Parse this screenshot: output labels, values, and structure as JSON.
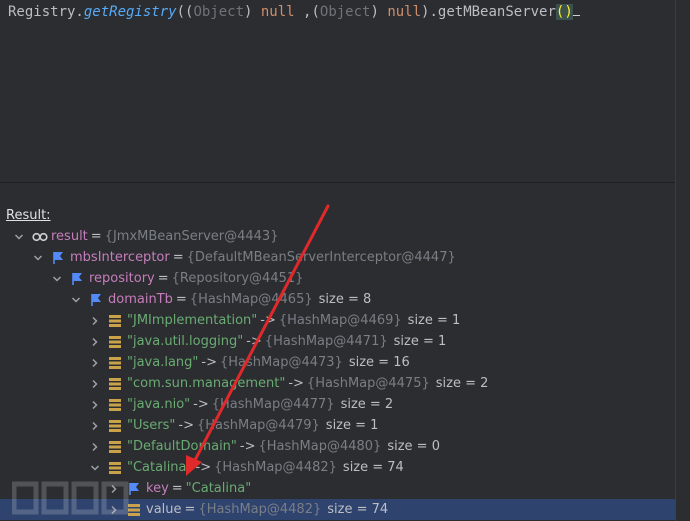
{
  "editor": {
    "tokens": {
      "registry": "Registry.",
      "getRegistry": "getRegistry",
      "open1": "((",
      "object1": "Object",
      "close1": ") ",
      "null1": "null",
      "comma": " ,(",
      "object2": "Object",
      "close2": ") ",
      "null2": "null",
      "tail": ").getMBeanServer",
      "parens": "()"
    }
  },
  "result_label": "Result:",
  "tree": [
    {
      "indent": 0,
      "expand": "down",
      "icon": "watch-icon",
      "name": "result",
      "name_style": "purple",
      "op": "=",
      "value": "{JmxMBeanServer@4443}",
      "size": ""
    },
    {
      "indent": 1,
      "expand": "down",
      "icon": "field-flag-icon",
      "name": "mbsInterceptor",
      "name_style": "purple",
      "op": "=",
      "value": "{DefaultMBeanServerInterceptor@4447}",
      "size": ""
    },
    {
      "indent": 2,
      "expand": "down",
      "icon": "field-flag-icon",
      "name": "repository",
      "name_style": "purple",
      "op": "=",
      "value": "{Repository@4451}",
      "size": ""
    },
    {
      "indent": 3,
      "expand": "down",
      "icon": "field-flag-icon",
      "name": "domainTb",
      "name_style": "purple",
      "op": "=",
      "value": "{HashMap@4465}",
      "size": "size = 8"
    },
    {
      "indent": 4,
      "expand": "right",
      "icon": "map-entry-icon",
      "name": "\"JMImplementation\"",
      "name_style": "str",
      "op": "->",
      "value": "{HashMap@4469}",
      "size": "size = 1"
    },
    {
      "indent": 4,
      "expand": "right",
      "icon": "map-entry-icon",
      "name": "\"java.util.logging\"",
      "name_style": "str",
      "op": "->",
      "value": "{HashMap@4471}",
      "size": "size = 1"
    },
    {
      "indent": 4,
      "expand": "right",
      "icon": "map-entry-icon",
      "name": "\"java.lang\"",
      "name_style": "str",
      "op": "->",
      "value": "{HashMap@4473}",
      "size": "size = 16"
    },
    {
      "indent": 4,
      "expand": "right",
      "icon": "map-entry-icon",
      "name": "\"com.sun.management\"",
      "name_style": "str",
      "op": "->",
      "value": "{HashMap@4475}",
      "size": "size = 2"
    },
    {
      "indent": 4,
      "expand": "right",
      "icon": "map-entry-icon",
      "name": "\"java.nio\"",
      "name_style": "str",
      "op": "->",
      "value": "{HashMap@4477}",
      "size": "size = 2"
    },
    {
      "indent": 4,
      "expand": "right",
      "icon": "map-entry-icon",
      "name": "\"Users\"",
      "name_style": "str",
      "op": "->",
      "value": "{HashMap@4479}",
      "size": "size = 1"
    },
    {
      "indent": 4,
      "expand": "right",
      "icon": "map-entry-icon",
      "name": "\"DefaultDomain\"",
      "name_style": "str",
      "op": "->",
      "value": "{HashMap@4480}",
      "size": "size = 0"
    },
    {
      "indent": 4,
      "expand": "down",
      "icon": "map-entry-icon",
      "name": "\"Catalina\"",
      "name_style": "str",
      "op": "->",
      "value": "{HashMap@4482}",
      "size": "size = 74"
    },
    {
      "indent": 5,
      "expand": "right",
      "icon": "field-flag-icon",
      "name": "key",
      "name_style": "purple",
      "op": "=",
      "value": "\"Catalina\"",
      "size": "",
      "value_style": "str"
    },
    {
      "indent": 5,
      "expand": "right",
      "icon": "map-entry-icon",
      "name": "value",
      "name_style": "plain",
      "op": "=",
      "value": "{HashMap@4482}",
      "size": "size = 74",
      "selected": true
    }
  ],
  "colors": {
    "background": "#2b2d30",
    "selection": "#2e436e",
    "annotation_arrow": "#e0292b"
  }
}
